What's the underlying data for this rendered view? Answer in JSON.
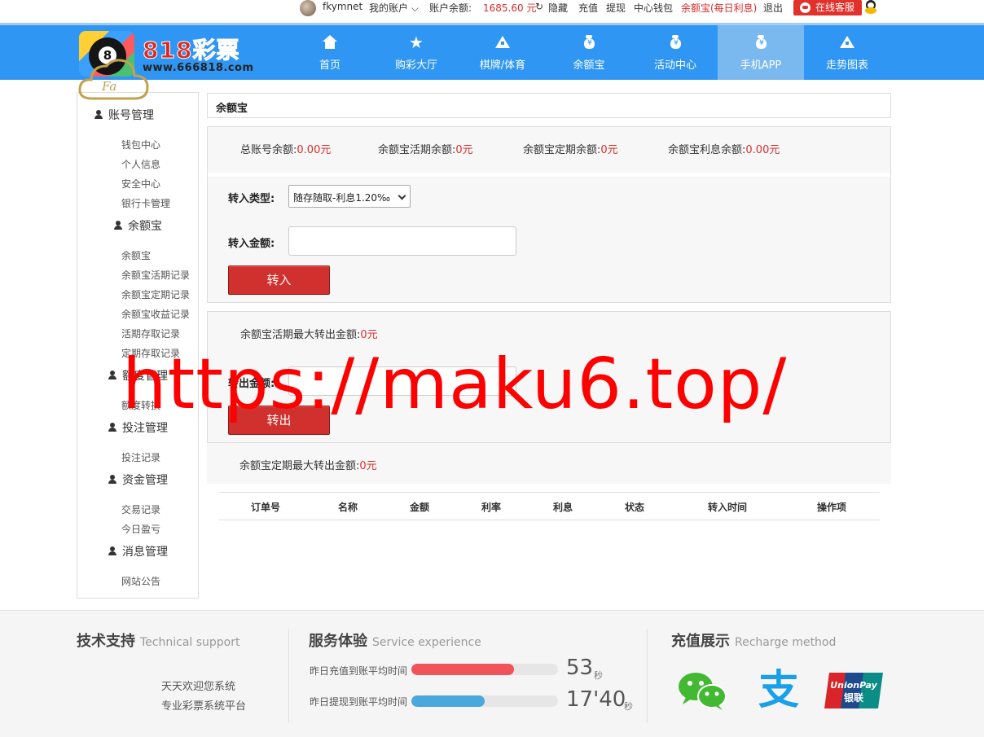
{
  "topbar": {
    "username": "fkymnet",
    "my_account": "我的账户",
    "balance_label": "账户余额:",
    "balance_value": "1685.60 元",
    "hide": "隐藏",
    "recharge": "充值",
    "withdraw": "提现",
    "wallet": "中心钱包",
    "yuebao_link": "余额宝(每日利息)",
    "logout": "退出",
    "online_service": "在线客服"
  },
  "logo": {
    "brand": "818彩票",
    "url": "www.666818.com",
    "ball_number": "8"
  },
  "nav": [
    {
      "label": "首页",
      "icon": "home-icon"
    },
    {
      "label": "购彩大厅",
      "icon": "star-icon"
    },
    {
      "label": "棋牌/体育",
      "icon": "triangle-icon"
    },
    {
      "label": "余额宝",
      "icon": "money-bag-icon"
    },
    {
      "label": "活动中心",
      "icon": "money-bag-icon"
    },
    {
      "label": "手机APP",
      "icon": "money-bag-icon",
      "active": true
    },
    {
      "label": "走势图表",
      "icon": "triangle-icon"
    }
  ],
  "sidebar": {
    "sections": [
      {
        "title": "账号管理",
        "items": [
          "钱包中心",
          "个人信息",
          "安全中心",
          "银行卡管理"
        ]
      },
      {
        "title": "余额宝",
        "items": [
          "余额宝",
          "余额宝活期记录",
          "余额宝定期记录",
          "余额宝收益记录",
          "活期存取记录",
          "定期存取记录"
        ]
      },
      {
        "title": "额度管理",
        "items": [
          "额度转换"
        ]
      },
      {
        "title": "投注管理",
        "items": [
          "投注记录"
        ]
      },
      {
        "title": "资金管理",
        "items": [
          "交易记录",
          "今日盈亏"
        ]
      },
      {
        "title": "消息管理",
        "items": [
          "网站公告"
        ]
      }
    ]
  },
  "main": {
    "title": "余额宝",
    "summary": [
      {
        "label": "总账号余额:",
        "value": "0.00元"
      },
      {
        "label": "余额宝活期余额:",
        "value": "0元"
      },
      {
        "label": "余额宝定期余额:",
        "value": "0元"
      },
      {
        "label": "余额宝利息余额:",
        "value": "0.00元"
      }
    ],
    "transfer_in": {
      "type_label": "转入类型:",
      "type_value": "随存随取-利息1.20‰",
      "amount_label": "转入金额:",
      "amount_value": "",
      "button": "转入"
    },
    "transfer_out": {
      "max_label": "余额宝活期最大转出金额:",
      "max_value": "0元",
      "amount_label": "转出金额:",
      "amount_value": "",
      "button": "转出"
    },
    "fixed": {
      "max_label": "余额宝定期最大转出金额:",
      "max_value": "0元"
    },
    "table_headers": [
      "订单号",
      "名称",
      "金额",
      "利率",
      "利息",
      "状态",
      "转入时间",
      "操作项"
    ]
  },
  "footer": {
    "support": {
      "title": "技术支持",
      "subtitle": "Technical support",
      "cloud_text": "Fa",
      "line1": "天天欢迎您系统",
      "line2": "专业彩票系统平台"
    },
    "service": {
      "title": "服务体验",
      "subtitle": "Service experience",
      "rows": [
        {
          "label": "昨日充值到账平均时间",
          "value": "53",
          "unit": "秒",
          "fill": 0.7,
          "color": "#f0545a"
        },
        {
          "label": "昨日提现到账平均时间",
          "value": "17'40",
          "unit": "秒",
          "fill": 0.5,
          "color": "#4aa8dc"
        }
      ]
    },
    "recharge": {
      "title": "充值展示",
      "subtitle": "Recharge method",
      "alipay_glyph": "支",
      "unionpay_text": "UnionPay",
      "unionpay_cn": "银联"
    }
  },
  "watermark": "https://maku6.top/"
}
